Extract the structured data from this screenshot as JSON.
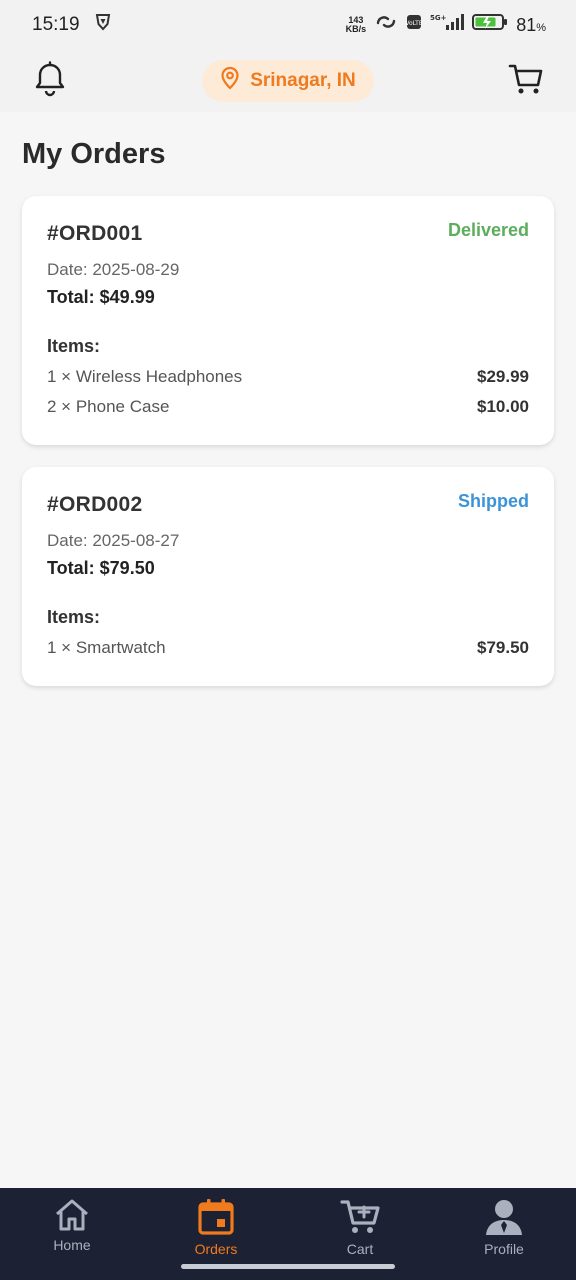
{
  "status_bar": {
    "time": "15:19",
    "net_speed_value": "143",
    "net_speed_unit": "KB/s",
    "network": "5G+",
    "battery_level": "81",
    "battery_unit": "%"
  },
  "header": {
    "location": "Srinagar, IN",
    "icons": [
      "bell-icon",
      "location-pin-icon",
      "cart-icon"
    ]
  },
  "page": {
    "title": "My Orders"
  },
  "orders": [
    {
      "id": "#ORD001",
      "status": "Delivered",
      "status_color": "#5cad5c",
      "date": "Date: 2025-08-29",
      "total": "Total: $49.99",
      "items_label": "Items:",
      "items": [
        {
          "name": "1 × Wireless Headphones",
          "price": "$29.99"
        },
        {
          "name": "2 × Phone Case",
          "price": "$10.00"
        }
      ]
    },
    {
      "id": "#ORD002",
      "status": "Shipped",
      "status_color": "#3d93d8",
      "date": "Date: 2025-08-27",
      "total": "Total: $79.50",
      "items_label": "Items:",
      "items": [
        {
          "name": "1 × Smartwatch",
          "price": "$79.50"
        }
      ]
    }
  ],
  "bottom_nav": {
    "items": [
      {
        "label": "Home",
        "icon": "home-icon",
        "active": false
      },
      {
        "label": "Orders",
        "icon": "calendar-icon",
        "active": true
      },
      {
        "label": "Cart",
        "icon": "cart-icon",
        "active": false
      },
      {
        "label": "Profile",
        "icon": "person-icon",
        "active": false
      }
    ],
    "active_color": "#f07a1e"
  }
}
